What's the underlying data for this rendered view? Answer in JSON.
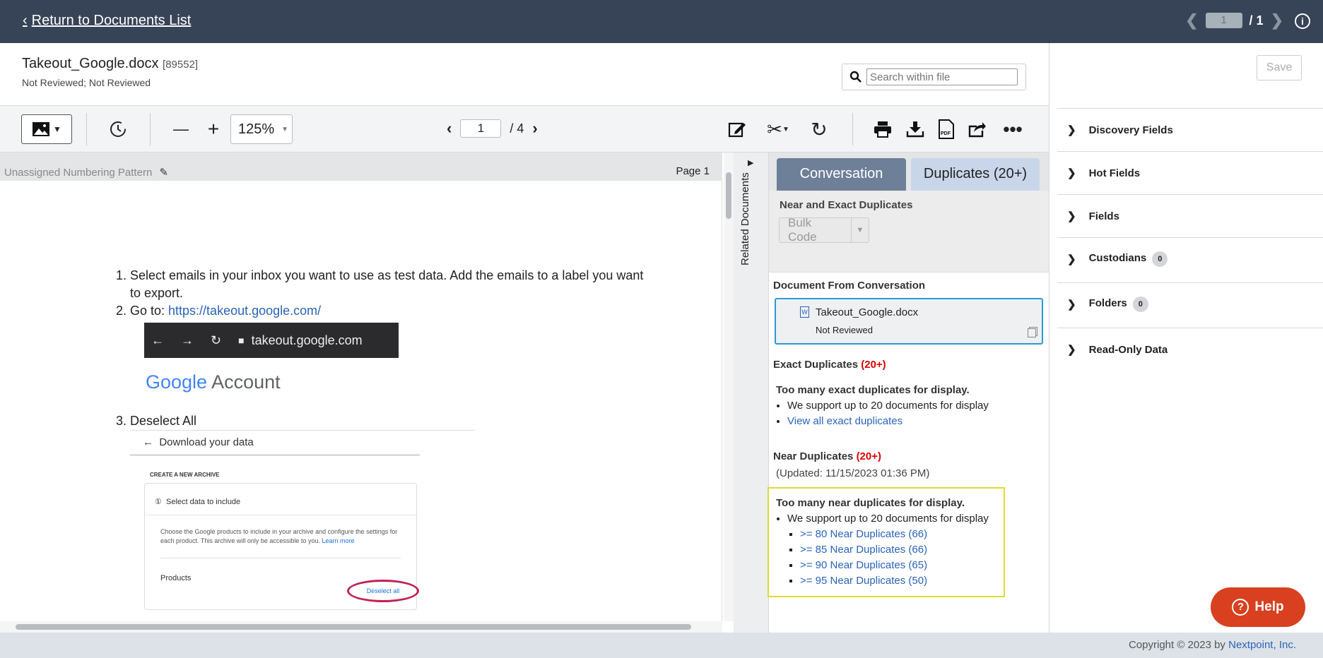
{
  "topbar": {
    "return_label": "Return to Documents List",
    "page_current": "1",
    "page_total": "/ 1"
  },
  "doc": {
    "title": "Takeout_Google.docx",
    "id": "[89552]",
    "status": "Not Reviewed; Not Reviewed",
    "search_placeholder": "Search within file"
  },
  "toolbar": {
    "zoom": "125%",
    "page": "1",
    "page_total": "/ 4"
  },
  "viewer": {
    "numbering": "Unassigned Numbering Pattern",
    "page_label": "Page 1",
    "step1": "Select emails in your inbox you want to use as test data. Add the emails to a label you want to export.",
    "step2_prefix": "Go to: ",
    "step2_link": "https://takeout.google.com/",
    "url_text": "takeout.google.com",
    "google_word": "Google",
    "account_word": "Account",
    "step3": "Deselect All",
    "shot_title": "Download your data",
    "shot_create": "CREATE A NEW ARCHIVE",
    "shot_step": "Select data to include",
    "shot_desc": "Choose the Google products to include in your archive and configure the settings for each product. This archive will only be accessible to you.",
    "shot_learn": "Learn more",
    "shot_products": "Products",
    "shot_deselect": "Deselect all"
  },
  "related": {
    "label": "Related Documents"
  },
  "dup": {
    "tab_conversation": "Conversation",
    "tab_duplicates": "Duplicates (20+)",
    "near_exact_title": "Near and Exact Duplicates",
    "bulk_code": "Bulk Code",
    "from_conv": "Document From Conversation",
    "card_name": "Takeout_Google.docx",
    "card_status": "Not Reviewed",
    "exact_title": "Exact Duplicates",
    "exact_count": "(20+)",
    "exact_msg": "Too many exact duplicates for display.",
    "exact_support": "We support up to 20 documents for display",
    "exact_link": "View all exact duplicates",
    "near_title": "Near Duplicates",
    "near_count": "(20+)",
    "near_updated": "(Updated: 11/15/2023 01:36 PM)",
    "near_msg": "Too many near duplicates for display.",
    "near_support": "We support up to 20 documents for display",
    "near_links": [
      ">= 80 Near Duplicates (66)",
      ">= 85 Near Duplicates (66)",
      ">= 90 Near Duplicates (65)",
      ">= 95 Near Duplicates (50)"
    ]
  },
  "right": {
    "save": "Save",
    "sections": [
      {
        "label": "Discovery Fields"
      },
      {
        "label": "Hot Fields"
      },
      {
        "label": "Fields"
      },
      {
        "label": "Custodians",
        "badge": "0"
      },
      {
        "label": "Folders",
        "badge": "0"
      },
      {
        "label": "Read-Only Data"
      }
    ]
  },
  "help": {
    "label": "Help"
  },
  "footer": {
    "copyright": "Copyright © 2023 by ",
    "company": "Nextpoint, Inc."
  },
  "colors": {
    "topbar": "#374457",
    "tab_active": "#6e7f98",
    "accent_red": "#d00000",
    "help": "#d8401f",
    "highlight_blue": "#2a9ad6",
    "highlight_yellow": "#e2da2e"
  }
}
